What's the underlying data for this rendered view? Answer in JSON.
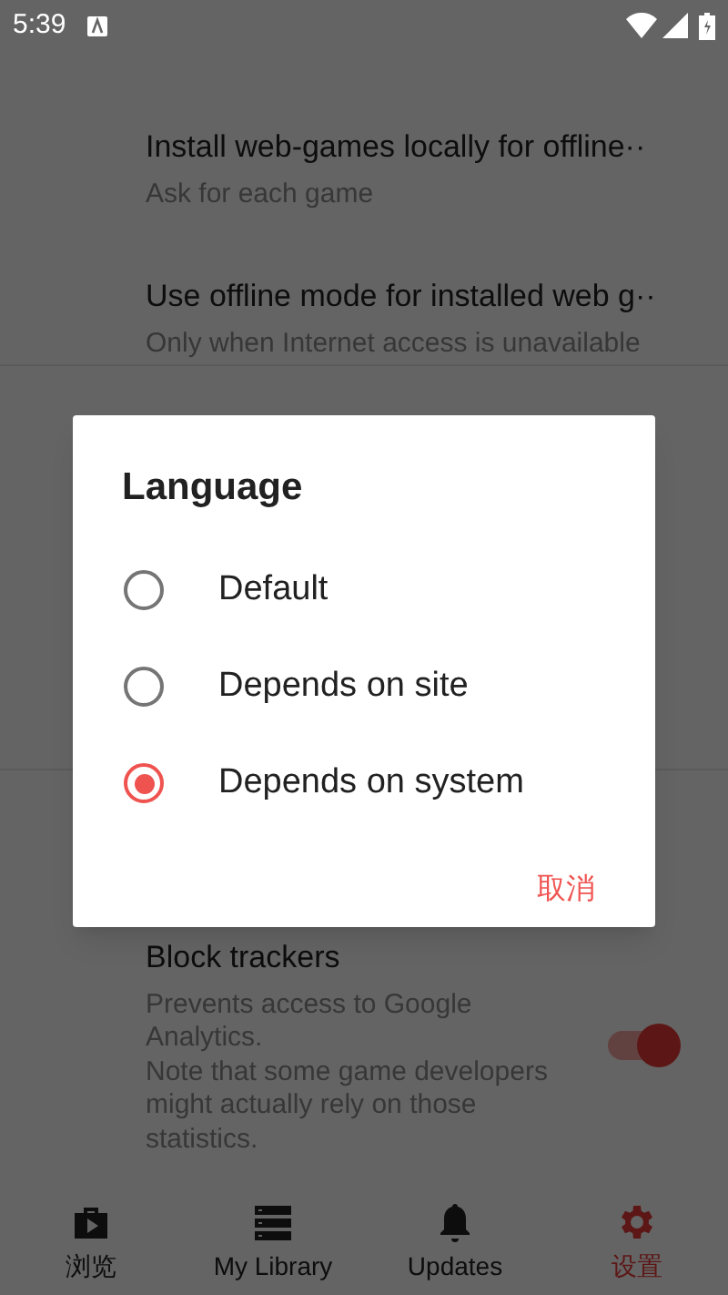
{
  "status_bar": {
    "time": "5:39"
  },
  "settings": [
    {
      "title": "Install web-games locally for offline··",
      "subtitle": "Ask for each game"
    },
    {
      "title": "Use offline mode for installed web g··",
      "subtitle": "Only when Internet access is unavailable"
    }
  ],
  "block_trackers": {
    "title": "Block trackers",
    "description": "Prevents access to Google Analytics.\nNote that some game developers might actually rely on those statistics.",
    "on": true
  },
  "bottom_nav": [
    {
      "label": "浏览",
      "kind": "browse",
      "selected": false
    },
    {
      "label": "My Library",
      "kind": "library",
      "selected": false
    },
    {
      "label": "Updates",
      "kind": "updates",
      "selected": false
    },
    {
      "label": "设置",
      "kind": "settings",
      "selected": true
    }
  ],
  "dialog": {
    "title": "Language",
    "options": [
      {
        "label": "Default",
        "selected": false
      },
      {
        "label": "Depends on site",
        "selected": false
      },
      {
        "label": "Depends on system",
        "selected": true
      }
    ],
    "cancel": "取消"
  }
}
